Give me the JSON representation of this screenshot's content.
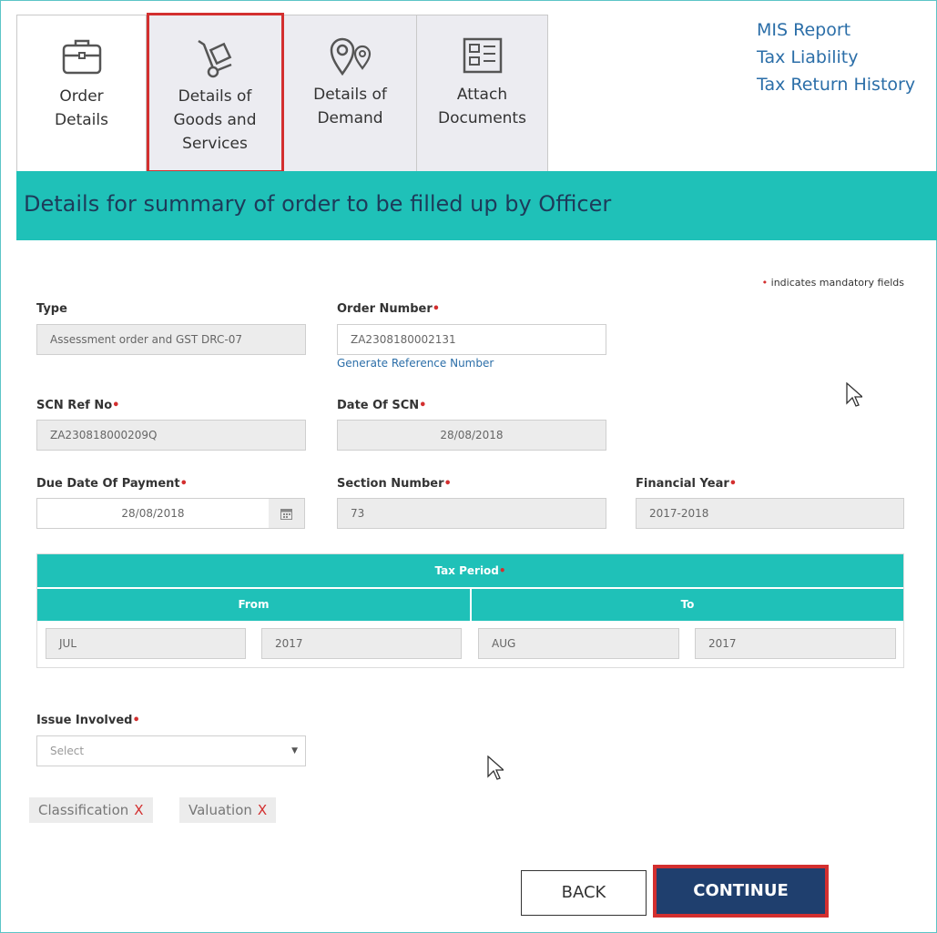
{
  "tabs": [
    {
      "label_line1": "Order",
      "label_line2": "Details",
      "label_line3": "",
      "icon": "briefcase-icon"
    },
    {
      "label_line1": "Details of",
      "label_line2": "Goods and",
      "label_line3": "Services",
      "icon": "hand-truck-icon"
    },
    {
      "label_line1": "Details of",
      "label_line2": "Demand",
      "label_line3": "",
      "icon": "location-pins-icon"
    },
    {
      "label_line1": "Attach",
      "label_line2": "Documents",
      "label_line3": "",
      "icon": "document-icon"
    }
  ],
  "side_links": [
    "MIS Report",
    "Tax Liability",
    "Tax Return History"
  ],
  "banner_title": "Details for summary of order to be filled up by Officer",
  "mandatory_note": "indicates mandatory fields",
  "required_mark": "•",
  "fields": {
    "type_label": "Type",
    "type_value": "Assessment order and GST DRC-07",
    "order_number_label": "Order Number",
    "order_number_value": "ZA2308180002131",
    "generate_ref_link": "Generate Reference Number",
    "scn_ref_label": "SCN Ref No",
    "scn_ref_value": "ZA230818000209Q",
    "date_scn_label": "Date Of SCN",
    "date_scn_value": "28/08/2018",
    "due_date_label": "Due Date Of Payment",
    "due_date_value": "28/08/2018",
    "section_number_label": "Section Number",
    "section_number_value": "73",
    "financial_year_label": "Financial Year",
    "financial_year_value": "2017-2018"
  },
  "tax_period": {
    "title": "Tax Period",
    "from_label": "From",
    "to_label": "To",
    "from_month": "JUL",
    "from_year": "2017",
    "to_month": "AUG",
    "to_year": "2017"
  },
  "issue": {
    "label": "Issue Involved",
    "select_value": "Select",
    "chips": [
      {
        "text": "Classification",
        "remove": "X"
      },
      {
        "text": "Valuation",
        "remove": "X"
      }
    ]
  },
  "buttons": {
    "back": "BACK",
    "continue": "CONTINUE"
  },
  "colors": {
    "teal": "#1fc1b8",
    "navy": "#1f3f6e",
    "highlight_red": "#d32f2f",
    "link_blue": "#2b6ea8"
  }
}
